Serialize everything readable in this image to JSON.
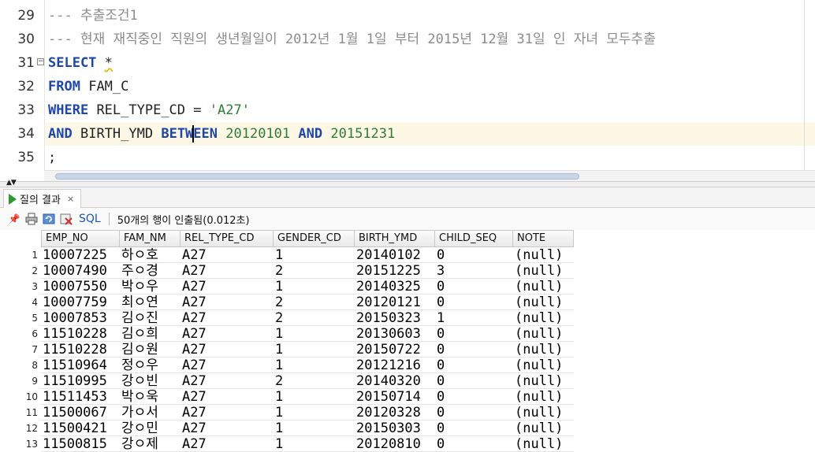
{
  "editor": {
    "lines": [
      {
        "no": "29"
      },
      {
        "no": "30"
      },
      {
        "no": "31"
      },
      {
        "no": "32"
      },
      {
        "no": "33"
      },
      {
        "no": "34"
      },
      {
        "no": "35"
      }
    ],
    "comment1": "--- 추출조건1",
    "comment2": "--- 현재 재직중인 직원의 생년월일이 2012년 1월 1일 부터 2015년 12월 31일 인 자녀 모두추출",
    "select_kw": "SELECT",
    "star": "*",
    "from_kw": "FROM",
    "table": "FAM_C",
    "where_kw": "WHERE",
    "where_col": "REL_TYPE_CD =",
    "where_val": "'A27'",
    "and_kw": "AND",
    "between_col": "BIRTH_YMD",
    "between_kw_a": "BETW",
    "between_kw_b": "EEN",
    "date_from": "20120101",
    "and_kw2": "AND",
    "date_to": "20151231",
    "terminator": ";"
  },
  "result_tab": {
    "label": "질의 결과",
    "close": "×"
  },
  "toolbar": {
    "sql_label": "SQL",
    "status": "50개의 행이 인출됨(0.012초)"
  },
  "grid": {
    "columns": [
      "EMP_NO",
      "FAM_NM",
      "REL_TYPE_CD",
      "GENDER_CD",
      "BIRTH_YMD",
      "CHILD_SEQ",
      "NOTE"
    ],
    "rows": [
      {
        "n": "1",
        "c": [
          "10007225",
          "하ㅇ호",
          "A27",
          "1",
          "20140102",
          "0",
          "(null)"
        ]
      },
      {
        "n": "2",
        "c": [
          "10007490",
          "주ㅇ경",
          "A27",
          "2",
          "20151225",
          "3",
          "(null)"
        ]
      },
      {
        "n": "3",
        "c": [
          "10007550",
          "박ㅇ우",
          "A27",
          "1",
          "20140325",
          "0",
          "(null)"
        ]
      },
      {
        "n": "4",
        "c": [
          "10007759",
          "최ㅇ연",
          "A27",
          "2",
          "20120121",
          "0",
          "(null)"
        ]
      },
      {
        "n": "5",
        "c": [
          "10007853",
          "김ㅇ진",
          "A27",
          "2",
          "20150323",
          "1",
          "(null)"
        ]
      },
      {
        "n": "6",
        "c": [
          "11510228",
          "김ㅇ희",
          "A27",
          "1",
          "20130603",
          "0",
          "(null)"
        ]
      },
      {
        "n": "7",
        "c": [
          "11510228",
          "김ㅇ원",
          "A27",
          "1",
          "20150722",
          "0",
          "(null)"
        ]
      },
      {
        "n": "8",
        "c": [
          "11510964",
          "정ㅇ우",
          "A27",
          "1",
          "20121216",
          "0",
          "(null)"
        ]
      },
      {
        "n": "9",
        "c": [
          "11510995",
          "강ㅇ빈",
          "A27",
          "2",
          "20140320",
          "0",
          "(null)"
        ]
      },
      {
        "n": "10",
        "c": [
          "11511453",
          "박ㅇ욱",
          "A27",
          "1",
          "20150714",
          "0",
          "(null)"
        ]
      },
      {
        "n": "11",
        "c": [
          "11500067",
          "가ㅇ서",
          "A27",
          "1",
          "20120328",
          "0",
          "(null)"
        ]
      },
      {
        "n": "12",
        "c": [
          "11500421",
          "강ㅇ민",
          "A27",
          "1",
          "20150303",
          "0",
          "(null)"
        ]
      },
      {
        "n": "13",
        "c": [
          "11500815",
          "강ㅇ제",
          "A27",
          "1",
          "20120810",
          "0",
          "(null)"
        ]
      }
    ]
  }
}
